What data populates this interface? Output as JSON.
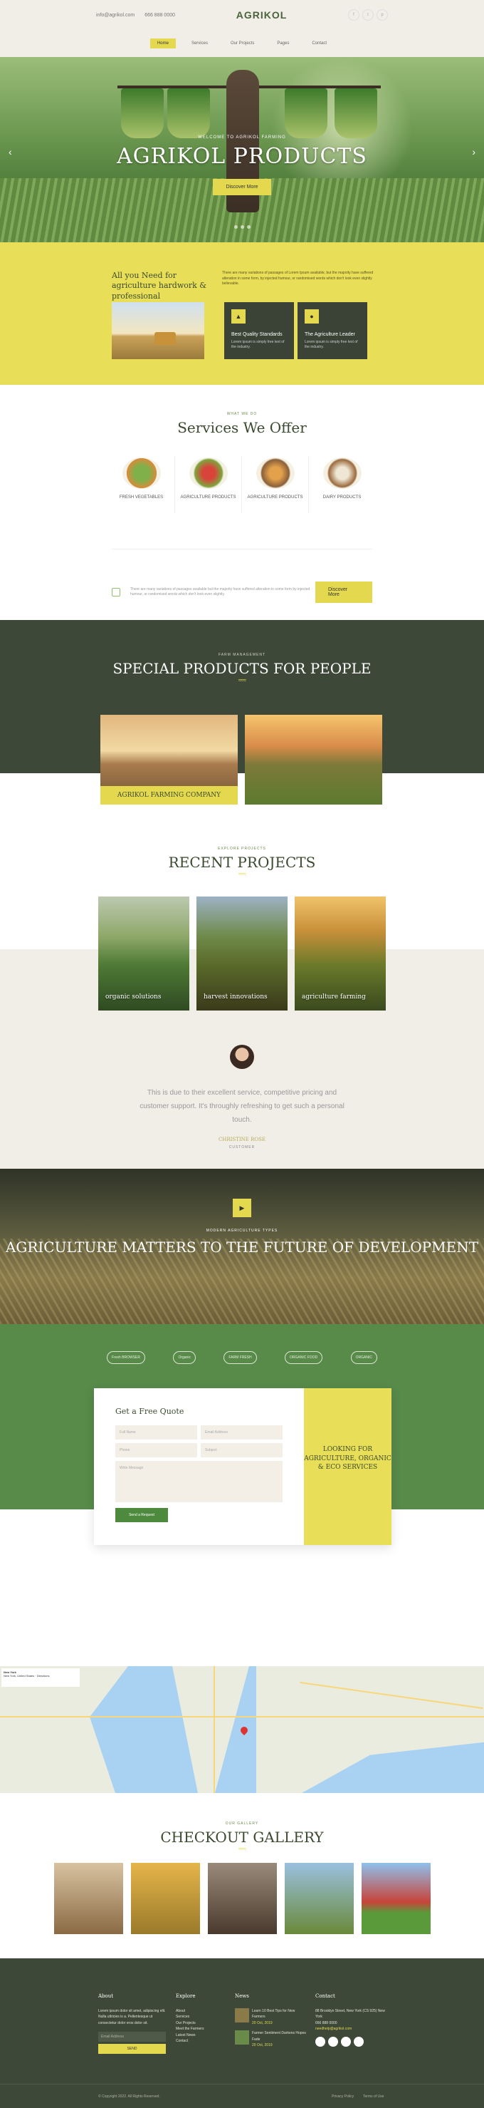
{
  "header": {
    "email": "info@agrikol.com",
    "phone": "666 888 0000",
    "logo": "AGRIKOL",
    "social": [
      "f",
      "t",
      "p"
    ]
  },
  "nav": [
    "Home",
    "Services",
    "Our Projects",
    "Pages",
    "Contact"
  ],
  "hero": {
    "kicker": "WELCOME TO AGRIKOL FARMING",
    "title": "AGRIKOL PRODUCTS",
    "button": "Discover More"
  },
  "intro": {
    "heading": "All you Need for agriculture hardwork & professional",
    "paragraph": "There are many variations of passages of Lorem Ipsum available, but the majority have suffered alteration in some form, by injected humour, or randomised words which don't look even slightly believable.",
    "cards": [
      {
        "title": "Best Quality Standards",
        "text": "Lorem ipsum is simply free text of the industry."
      },
      {
        "title": "The Agriculture Leader",
        "text": "Lorem ipsum is simply free text of the industry."
      }
    ]
  },
  "services": {
    "kicker": "WHAT WE DO",
    "title": "Services We Offer",
    "items": [
      "FRESH VEGETABLES",
      "AGRICULTURE PRODUCTS",
      "AGRICULTURE PRODUCTS",
      "DAIRY PRODUCTS"
    ],
    "notice": "There are many variations of passages available but the majority have suffered alteration in some form by injected humour, or randomised words which don't look even slightly.",
    "button": "Discover More"
  },
  "special": {
    "kicker": "FARM MANAGEMENT",
    "title": "SPECIAL PRODUCTS FOR PEOPLE",
    "label": "AGRIKOL FARMING COMPANY"
  },
  "projects": {
    "kicker": "EXPLORE PROJECTS",
    "title": "RECENT PROJECTS",
    "items": [
      "organic solutions",
      "harvest innovations",
      "agriculture farming"
    ]
  },
  "testimonial": {
    "quote": "This is due to their excellent service, competitive pricing and customer support. It's throughly refreshing to get such a personal touch.",
    "name": "CHRISTINE ROSE",
    "role": "CUSTOMER"
  },
  "agriculture": {
    "kicker": "MODERN AGRICULTURE TYPES",
    "title": "AGRICULTURE MATTERS TO THE FUTURE OF DEVELOPMENT"
  },
  "brands": [
    "Fresh BROWSER",
    "Organic",
    "FARM FRESH",
    "ORGANIC FOOD",
    "ORGANIC"
  ],
  "quote": {
    "title": "Get a Free Quote",
    "fields": [
      "Full Name",
      "Email Address",
      "Phone",
      "Subject",
      "Write Message"
    ],
    "button": "Send a Request",
    "side": "LOOKING FOR AGRICULTURE, ORGANIC & ECO SERVICES"
  },
  "map": {
    "label": "New York",
    "sub": "New York, United States · Directions"
  },
  "gallery": {
    "kicker": "OUR GALLERY",
    "title": "CHECKOUT GALLERY"
  },
  "footer": {
    "about_title": "About",
    "about_text": "Lorem ipsum dolor sit amet, adipiscing elit. Nulla ultricies is a. Pellentesque ut consectetur dolor eros dolor sit.",
    "email_placeholder": "Email Address",
    "send": "SEND",
    "explore_title": "Explore",
    "explore": [
      "About",
      "Services",
      "Our Projects",
      "Meet the Farmers",
      "Latest News",
      "Contact"
    ],
    "news_title": "News",
    "news": [
      {
        "title": "Learn 10 Best Tips for New Farmers",
        "date": "20 Oct, 2019"
      },
      {
        "title": "Farmer Sentiment Darkens Hopes Fade",
        "date": "20 Oct, 2019"
      }
    ],
    "contact_title": "Contact",
    "address": "88 Brooklyn Street, New York (CS 925) New York",
    "phone": "666 888 0000",
    "email": "needhelp@agrikol.com",
    "copyright": "© Copyright 2022. All Rights Reserved.",
    "links": [
      "Privacy Policy",
      "Terms of Use"
    ]
  }
}
